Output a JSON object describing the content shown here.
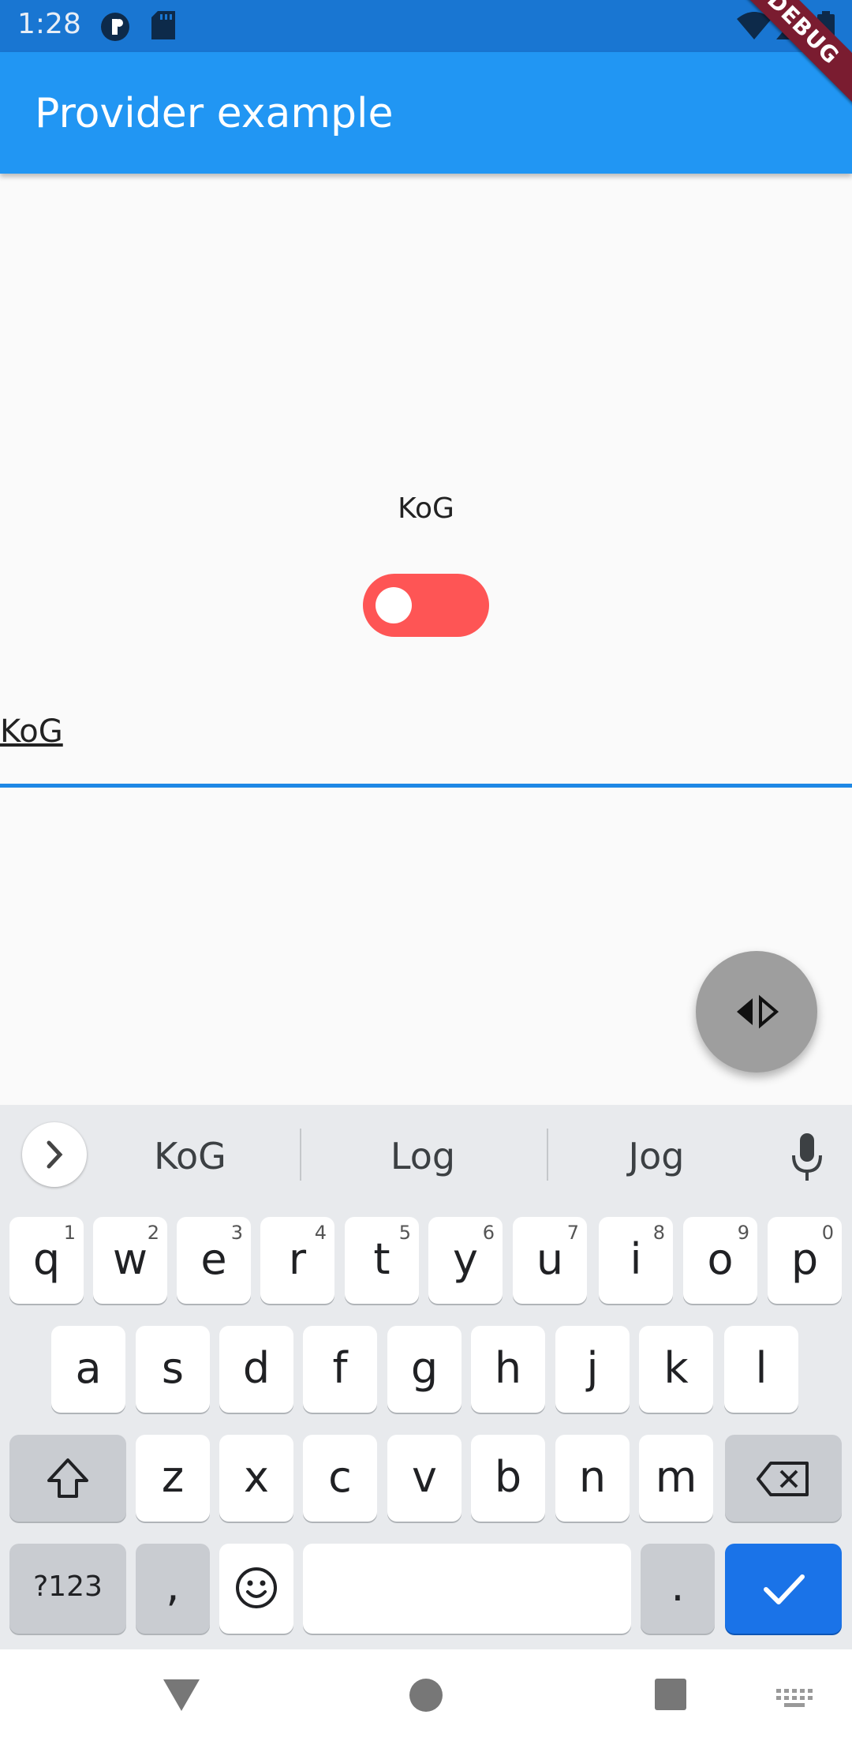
{
  "status_bar": {
    "time": "1:28"
  },
  "app_bar": {
    "title": "Provider example",
    "debug_banner": "DEBUG"
  },
  "content": {
    "label_text": "KoG",
    "switch": {
      "on": false,
      "color": "#fe5555"
    },
    "text_field": {
      "value": "KoG",
      "underline_color": "#1e88e5"
    },
    "fab_icon": "swap-horizontal-icon"
  },
  "keyboard": {
    "suggestions": [
      "KoG",
      "Log",
      "Jog"
    ],
    "row1": [
      {
        "ch": "q",
        "hint": "1"
      },
      {
        "ch": "w",
        "hint": "2"
      },
      {
        "ch": "e",
        "hint": "3"
      },
      {
        "ch": "r",
        "hint": "4"
      },
      {
        "ch": "t",
        "hint": "5"
      },
      {
        "ch": "y",
        "hint": "6"
      },
      {
        "ch": "u",
        "hint": "7"
      },
      {
        "ch": "i",
        "hint": "8"
      },
      {
        "ch": "o",
        "hint": "9"
      },
      {
        "ch": "p",
        "hint": "0"
      }
    ],
    "row2": [
      "a",
      "s",
      "d",
      "f",
      "g",
      "h",
      "j",
      "k",
      "l"
    ],
    "row3": [
      "z",
      "x",
      "c",
      "v",
      "b",
      "n",
      "m"
    ],
    "symbols_key": "?123",
    "comma_key": ",",
    "period_key": "."
  },
  "colors": {
    "status_bar": "#1976d2",
    "app_bar": "#2196f3",
    "enter_key": "#1a73e8"
  }
}
